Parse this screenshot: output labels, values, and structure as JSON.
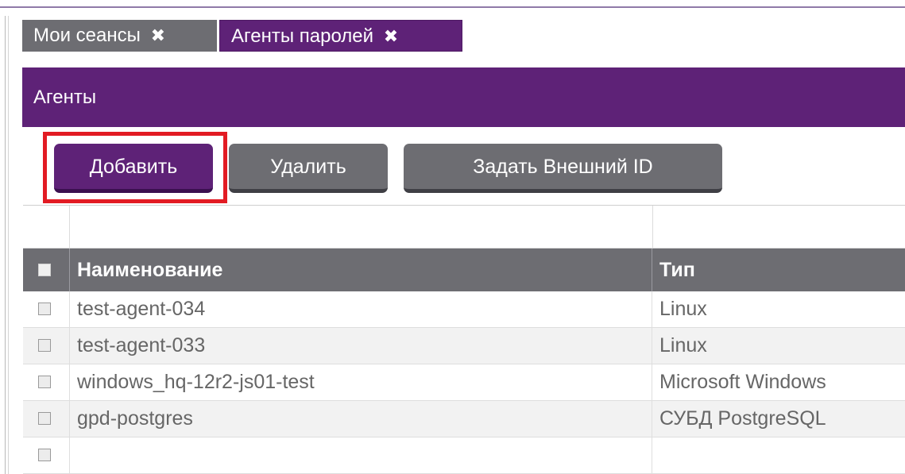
{
  "tabs": [
    {
      "label": "Мои сеансы",
      "close": "✖"
    },
    {
      "label": "Агенты паролей",
      "close": "✖"
    }
  ],
  "panel": {
    "title": "Агенты"
  },
  "toolbar": {
    "add_label": "Добавить",
    "delete_label": "Удалить",
    "external_id_label": "Задать Внешний ID"
  },
  "grid": {
    "columns": [
      "Наименование",
      "Тип"
    ],
    "rows": [
      {
        "name": "test-agent-034",
        "type": "Linux"
      },
      {
        "name": "test-agent-033",
        "type": "Linux"
      },
      {
        "name": "windows_hq-12r2-js01-test",
        "type": "Microsoft Windows"
      },
      {
        "name": "gpd-postgres",
        "type": "СУБД PostgreSQL"
      }
    ]
  },
  "colors": {
    "accent": "#5e2277",
    "neutral": "#6d6d72",
    "highlight": "#e21b23"
  }
}
